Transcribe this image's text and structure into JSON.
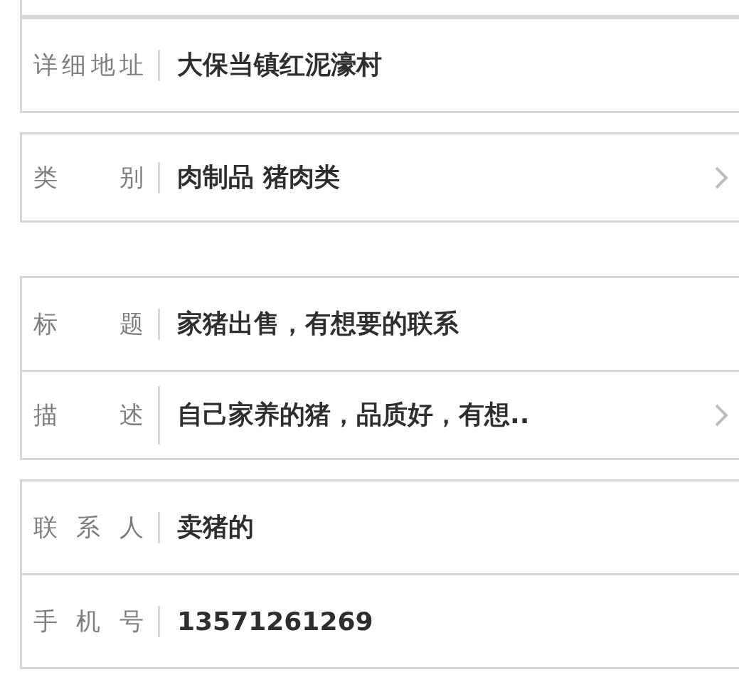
{
  "groups": [
    {
      "rows": [
        {
          "label": "详细地址",
          "value": "大保当镇红泥濠村",
          "arrow": false
        }
      ]
    },
    {
      "rows": [
        {
          "label": "类 别",
          "value": "肉制品 猪肉类",
          "arrow": true
        }
      ]
    },
    {
      "rows": [
        {
          "label": "标 题",
          "value": "家猪出售，有想要的联系",
          "arrow": false
        },
        {
          "label": "描 述",
          "value": "自己家养的猪，品质好，有想..",
          "arrow": true
        }
      ]
    },
    {
      "rows": [
        {
          "label": "联 系 人",
          "value": "卖猪的",
          "arrow": false
        },
        {
          "label": "手 机 号",
          "value": "13571261269",
          "arrow": false
        }
      ]
    }
  ]
}
